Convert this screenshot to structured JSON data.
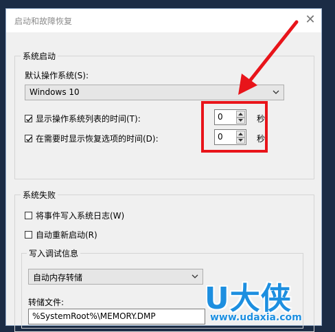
{
  "window": {
    "title": "启动和故障恢复",
    "close_glyph": "✕"
  },
  "system_startup": {
    "group_label": "系统启动",
    "default_os_label": "默认操作系统(S):",
    "default_os_value": "Windows 10",
    "show_os_list": {
      "label": "显示操作系统列表的时间(T):",
      "checked": true,
      "value": "0"
    },
    "show_recovery": {
      "label": "在需要时显示恢复选项的时间(D):",
      "checked": true,
      "value": "0"
    },
    "unit": "秒"
  },
  "system_failure": {
    "group_label": "系统失败",
    "write_event": {
      "label": "将事件写入系统日志(W)",
      "checked": false
    },
    "auto_restart": {
      "label": "自动重新启动(R)",
      "checked": false
    },
    "debug": {
      "group_label": "写入调试信息",
      "type_value": "自动内存转储",
      "dump_file_label": "转储文件:",
      "dump_file_value": "%SystemRoot%\\MEMORY.DMP"
    }
  },
  "watermark": {
    "logo": "U大侠",
    "url": "www.udaxia.com"
  },
  "colors": {
    "highlight": "#e8141a",
    "watermark": "#1d8fe0"
  }
}
